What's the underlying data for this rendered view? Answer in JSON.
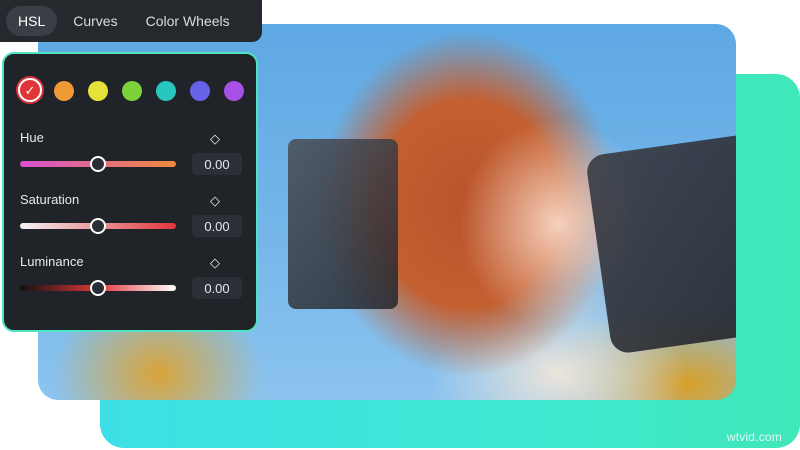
{
  "tabs": [
    {
      "label": "HSL",
      "active": true
    },
    {
      "label": "Curves",
      "active": false
    },
    {
      "label": "Color Wheels",
      "active": false
    }
  ],
  "swatches": {
    "selected_check": "✓",
    "colors": [
      "#e0363a",
      "#ee9a35",
      "#e7e23a",
      "#7dd13a",
      "#29c6c0",
      "#6663e8",
      "#a851e6"
    ],
    "selected_index": 0
  },
  "adjustments": [
    {
      "label": "Hue",
      "value": "0.00",
      "keyframe_icon": "◇",
      "level": 0.5,
      "track_colors": [
        "#d94fd0",
        "#ee8a3c"
      ]
    },
    {
      "label": "Saturation",
      "value": "0.00",
      "keyframe_icon": "◇",
      "level": 0.5,
      "track_colors": [
        "#f4f4f4",
        "#e0363a"
      ]
    },
    {
      "label": "Luminance",
      "value": "0.00",
      "keyframe_icon": "◇",
      "level": 0.5,
      "track_colors": [
        "#111111",
        "#e0363a",
        "#ffffff"
      ]
    }
  ],
  "watermark": "wtvid.com",
  "accent_color": "#4ee3c2"
}
